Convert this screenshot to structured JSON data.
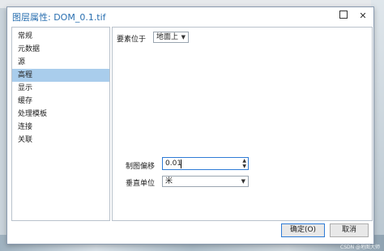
{
  "dialog": {
    "title": "图层属性: DOM_0.1.tif",
    "minimize_label": "□",
    "close_label": "✕"
  },
  "nav": {
    "items": [
      "常规",
      "元数据",
      "源",
      "高程",
      "显示",
      "缓存",
      "处理模板",
      "连接",
      "关联"
    ],
    "selected": "高程"
  },
  "elevation": {
    "features_label": "要素位于",
    "features_value": "地面上",
    "offset_label": "制图偏移",
    "offset_value": "0.01",
    "unit_label": "垂直单位",
    "unit_value": "米"
  },
  "buttons": {
    "ok": "确定(O)",
    "cancel": "取消"
  },
  "watermark": "CSDN @地图大师"
}
